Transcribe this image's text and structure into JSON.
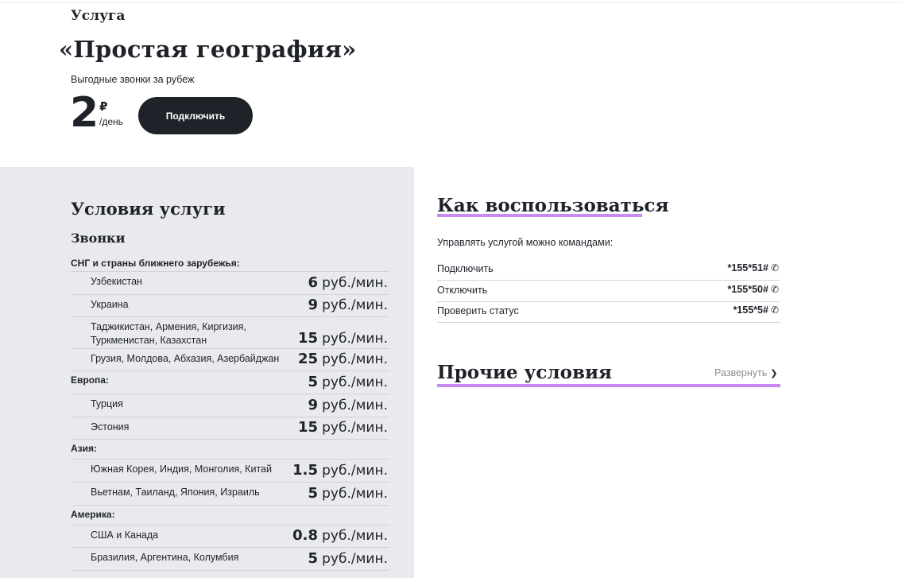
{
  "hero": {
    "kicker": "Услуга",
    "title": "«Простая география»",
    "subtitle": "Выгодные звонки за рубеж",
    "price_value": "2",
    "price_currency": "₽",
    "price_period": "/день",
    "connect_label": "Подключить"
  },
  "conditions": {
    "title": "Условия услуги",
    "calls_title": "Звонки",
    "rows": [
      {
        "type": "group",
        "name": "СНГ и страны ближнего зарубежья:"
      },
      {
        "type": "item",
        "name": "Узбекистан",
        "value": "6",
        "unit": "руб./мин."
      },
      {
        "type": "item",
        "name": "Украина",
        "value": "9",
        "unit": "руб./мин."
      },
      {
        "type": "item",
        "name": "Таджикистан, Армения, Киргизия, Туркменистан, Казахстан",
        "value": "15",
        "unit": "руб./мин."
      },
      {
        "type": "item",
        "name": "Грузия, Молдова, Абхазия, Азербайджан",
        "value": "25",
        "unit": "руб./мин."
      },
      {
        "type": "group",
        "name": "Европа:",
        "value": "5",
        "unit": "руб./мин."
      },
      {
        "type": "item",
        "name": "Турция",
        "value": "9",
        "unit": "руб./мин."
      },
      {
        "type": "item",
        "name": "Эстония",
        "value": "15",
        "unit": "руб./мин."
      },
      {
        "type": "group",
        "name": "Азия:"
      },
      {
        "type": "item",
        "name": "Южная Корея, Индия, Монголия, Китай",
        "value": "1.5",
        "unit": "руб./мин."
      },
      {
        "type": "item",
        "name": "Вьетнам, Таиланд, Япония, Израиль",
        "value": "5",
        "unit": "руб./мин."
      },
      {
        "type": "group",
        "name": "Америка:"
      },
      {
        "type": "item",
        "name": "США и Канада",
        "value": "0.8",
        "unit": "руб./мин."
      },
      {
        "type": "item",
        "name": "Бразилия, Аргентина, Колумбия",
        "value": "5",
        "unit": "руб./мин."
      }
    ]
  },
  "how_to": {
    "title": "Как воспользоваться",
    "subtitle": "Управлять услугой можно командами:",
    "commands": [
      {
        "label": "Подключить",
        "code": "*155*51#"
      },
      {
        "label": "Отключить",
        "code": "*155*50#"
      },
      {
        "label": "Проверить статус",
        "code": "*155*5#"
      }
    ]
  },
  "other": {
    "title": "Прочие условия",
    "expand_label": "Развернуть"
  },
  "colors": {
    "accent": "#c889f0",
    "dark": "#1f2229",
    "panel": "#e9eaed"
  }
}
